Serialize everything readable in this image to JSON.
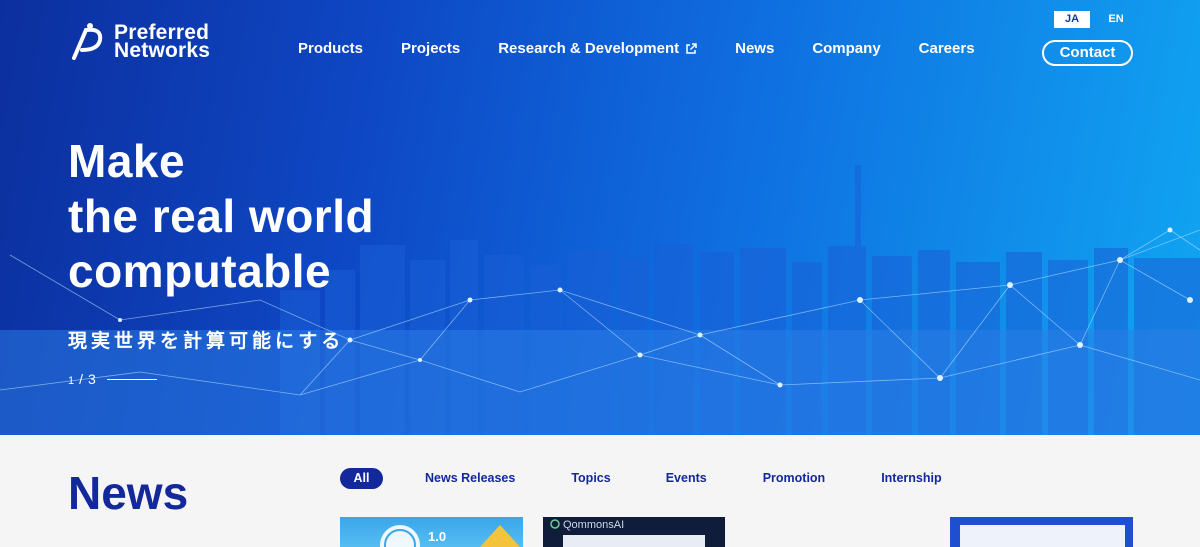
{
  "brand": {
    "line1": "Preferred",
    "line2": "Networks"
  },
  "lang": {
    "ja": "JA",
    "en": "EN"
  },
  "nav": {
    "products": "Products",
    "projects": "Projects",
    "research": "Research & Development",
    "news": "News",
    "company": "Company",
    "careers": "Careers",
    "contact": "Contact"
  },
  "hero": {
    "line1": "Make",
    "line2": "the real world",
    "line3": "computable",
    "subtitle": "現実世界を計算可能にする",
    "pager_current": "1",
    "pager_sep": "/",
    "pager_total": "3"
  },
  "news": {
    "title": "News",
    "tabs": [
      "All",
      "News Releases",
      "Topics",
      "Events",
      "Promotion",
      "Internship"
    ]
  },
  "cards": {
    "card1_badge": "1.0",
    "card2_title": "QommonsAI"
  },
  "colors": {
    "accent": "#13289b",
    "hero_start": "#0c2f9e",
    "hero_end": "#10a6f2"
  }
}
